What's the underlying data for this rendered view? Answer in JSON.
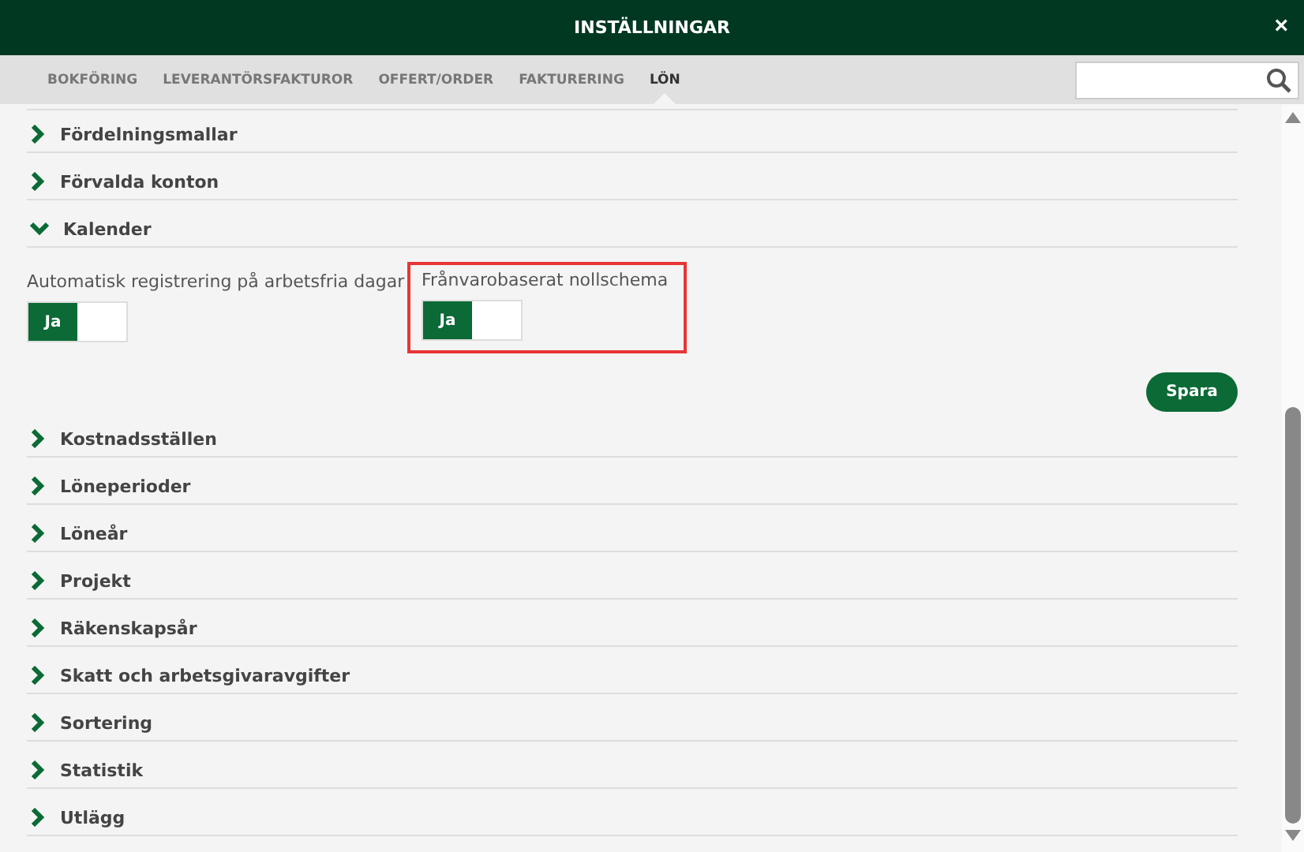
{
  "window": {
    "title": "INSTÄLLNINGAR",
    "close": "×"
  },
  "tabs": [
    {
      "label": "BOKFÖRING",
      "selected": false
    },
    {
      "label": "LEVERANTÖRSFAKTUROR",
      "selected": false
    },
    {
      "label": "OFFERT/ORDER",
      "selected": false
    },
    {
      "label": "FAKTURERING",
      "selected": false
    },
    {
      "label": "LÖN",
      "selected": true
    }
  ],
  "sections": [
    {
      "title": "Fördelningsmallar",
      "expanded": false
    },
    {
      "title": "Förvalda konton",
      "expanded": false
    },
    {
      "title": "Kalender",
      "expanded": true,
      "settings": [
        {
          "label": "Automatisk registrering på arbetsfria dagar",
          "on_label": "Ja",
          "on": true,
          "highlighted": false
        },
        {
          "label": "Frånvarobaserat nollschema",
          "on_label": "Ja",
          "on": true,
          "highlighted": true
        }
      ],
      "save_button": "Spara"
    },
    {
      "title": "Kostnadsställen",
      "expanded": false
    },
    {
      "title": "Löneperioder",
      "expanded": false
    },
    {
      "title": "Löneår",
      "expanded": false
    },
    {
      "title": "Projekt",
      "expanded": false
    },
    {
      "title": "Räkenskapsår",
      "expanded": false
    },
    {
      "title": "Skatt och arbetsgivaravgifter",
      "expanded": false
    },
    {
      "title": "Sortering",
      "expanded": false
    },
    {
      "title": "Statistik",
      "expanded": false
    },
    {
      "title": "Utlägg",
      "expanded": false
    }
  ]
}
